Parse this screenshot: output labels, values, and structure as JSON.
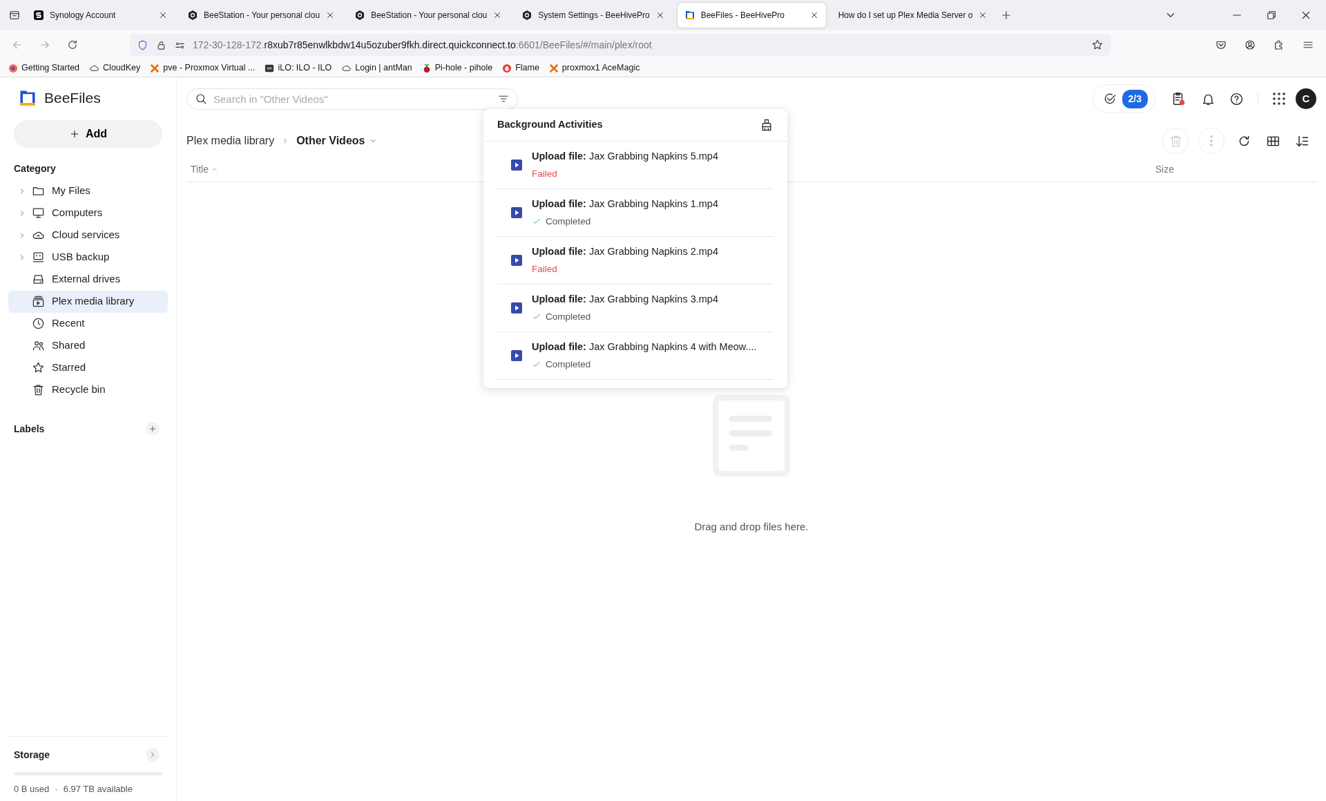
{
  "browser": {
    "tabs": [
      {
        "title": "Synology Account",
        "selected": false
      },
      {
        "title": "BeeStation - Your personal clou",
        "selected": false
      },
      {
        "title": "BeeStation - Your personal clou",
        "selected": false
      },
      {
        "title": "System Settings - BeeHivePro",
        "selected": false
      },
      {
        "title": "BeeFiles - BeeHivePro",
        "selected": true
      },
      {
        "title": "How do I set up Plex Media Server o",
        "selected": false
      }
    ],
    "url": {
      "prefix": "172-30-128-172.",
      "domain": "r8xub7r85enwlkbdw14u5ozuber9fkh.direct.quickconnect.to",
      "suffix": ":6601/BeeFiles/#/main/plex/root"
    },
    "bookmarks": [
      "Getting Started",
      "CloudKey",
      "pve - Proxmox Virtual ...",
      "iLO: ILO - ILO",
      "Login | antMan",
      "Pi-hole - pihole",
      "Flame",
      "proxmox1 AceMagic"
    ]
  },
  "app": {
    "name": "BeeFiles",
    "add_button": "Add",
    "category_title": "Category",
    "sidebar": {
      "items": [
        {
          "label": "My Files",
          "expandable": true,
          "selected": false
        },
        {
          "label": "Computers",
          "expandable": true,
          "selected": false
        },
        {
          "label": "Cloud services",
          "expandable": true,
          "selected": false
        },
        {
          "label": "USB backup",
          "expandable": true,
          "selected": false
        },
        {
          "label": "External drives",
          "expandable": false,
          "selected": false
        },
        {
          "label": "Plex media library",
          "expandable": false,
          "selected": true
        },
        {
          "label": "Recent",
          "expandable": false,
          "selected": false
        },
        {
          "label": "Shared",
          "expandable": false,
          "selected": false
        },
        {
          "label": "Starred",
          "expandable": false,
          "selected": false
        },
        {
          "label": "Recycle bin",
          "expandable": false,
          "selected": false
        }
      ]
    },
    "labels_title": "Labels",
    "storage": {
      "title": "Storage",
      "level": 0,
      "used": "0 B used",
      "separator": "·",
      "available": "6.97 TB available"
    },
    "search": {
      "placeholder": "Search in \"Other Videos\""
    },
    "task_badge": "2/3",
    "avatar": "C",
    "breadcrumb": [
      {
        "label": "Plex media library",
        "current": false
      },
      {
        "label": "Other Videos",
        "current": true
      }
    ],
    "toolbar_buttons": [
      {
        "disabled": true
      },
      {
        "disabled": true
      },
      {
        "disabled": false
      },
      {
        "disabled": false
      },
      {
        "disabled": false
      }
    ],
    "columns": [
      "Title",
      "Size"
    ],
    "empty_text": "Drag and drop files here.",
    "activities": {
      "title": "Background Activities",
      "items": [
        {
          "title": "**Upload file:** Jax Grabbing Napkins 5.mp4",
          "status": "Failed",
          "kind": "failed"
        },
        {
          "title": "**Upload file:** Jax Grabbing Napkins 1.mp4",
          "status": "Completed",
          "kind": "completed"
        },
        {
          "title": "**Upload file:** Jax Grabbing Napkins 2.mp4",
          "status": "Failed",
          "kind": "failed"
        },
        {
          "title": "**Upload file:** Jax Grabbing Napkins 3.mp4",
          "status": "Completed",
          "kind": "completed"
        },
        {
          "title": "**Upload file:** Jax Grabbing Napkins 4 with Meow....",
          "status": "Completed",
          "kind": "completed"
        }
      ]
    }
  }
}
